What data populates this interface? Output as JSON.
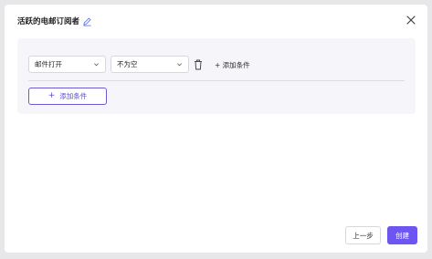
{
  "dialog": {
    "title": "活跃的电邮订阅者",
    "edit_icon": "pencil-icon",
    "close_icon": "close-icon"
  },
  "condition": {
    "field_value": "邮件打开",
    "operator_value": "不为空",
    "delete_icon": "trash-icon",
    "inline_add_label": "+ 添加条件"
  },
  "add_condition_button": {
    "icon": "plus-icon",
    "label": "添加条件"
  },
  "footer": {
    "prev_label": "上一步",
    "create_label": "创建"
  },
  "colors": {
    "accent": "#6c55f0",
    "outline_accent": "#6b5bd6",
    "panel_bg": "#f6f6fa",
    "page_bg": "#e7e7ea"
  }
}
